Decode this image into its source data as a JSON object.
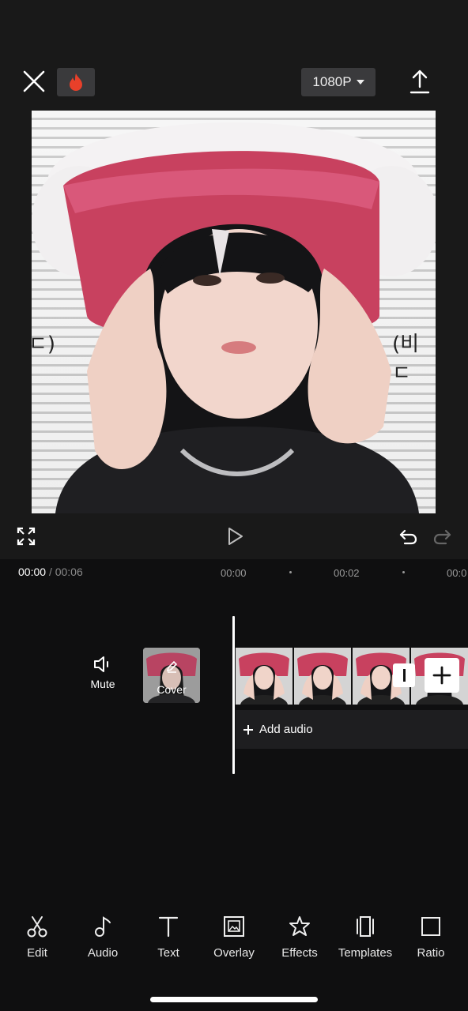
{
  "topbar": {
    "resolution": "1080P"
  },
  "preview": {
    "left_text": "ㄷ)",
    "right_text": "(비ㄷ"
  },
  "timeline": {
    "current_time": "00:00",
    "separator": "/",
    "total_time": "00:06",
    "ruler_labels": [
      "00:00",
      "00:02",
      "00:0"
    ]
  },
  "track": {
    "mute_label": "Mute",
    "cover_label": "Cover",
    "add_audio_label": "Add audio"
  },
  "toolbar": {
    "items": [
      {
        "label": "Edit",
        "icon": "scissors-icon"
      },
      {
        "label": "Audio",
        "icon": "music-note-icon"
      },
      {
        "label": "Text",
        "icon": "text-icon"
      },
      {
        "label": "Overlay",
        "icon": "overlay-icon"
      },
      {
        "label": "Effects",
        "icon": "effects-star-icon"
      },
      {
        "label": "Templates",
        "icon": "templates-icon"
      },
      {
        "label": "Ratio",
        "icon": "ratio-icon"
      }
    ]
  },
  "colors": {
    "background": "#0f0f10",
    "panel": "#191919",
    "button": "#3a3a3c",
    "hat_pink": "#c8415f",
    "fire": "#e8402a"
  }
}
